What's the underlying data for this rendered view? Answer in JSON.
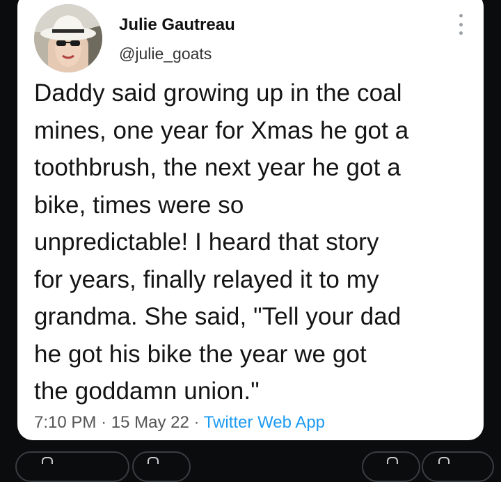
{
  "tweet": {
    "author": {
      "display_name": "Julie Gautreau",
      "handle": "@julie_goats"
    },
    "text_lines": [
      "Daddy said growing up in the coal",
      "mines, one year for Xmas he got a",
      "toothbrush, the next year he got a",
      "bike, times were so",
      "unpredictable! I heard that story",
      "for years, finally relayed it to my",
      "grandma. She said, \"Tell your dad",
      "he got his bike the year we got",
      "the goddamn union.\""
    ],
    "time": "7:10 PM",
    "date": "15 May 22",
    "separator": "·",
    "source": "Twitter Web App"
  },
  "icons": {
    "more": "more-vertical-icon"
  },
  "colors": {
    "background": "#0b0c0d",
    "card": "#ffffff",
    "text": "#141414",
    "link": "#1d9bf0",
    "meta": "#555555"
  }
}
